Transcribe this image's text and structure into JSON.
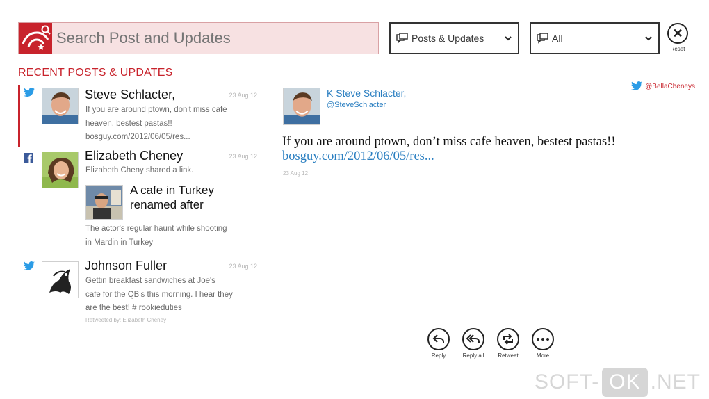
{
  "search": {
    "placeholder": "Search Post and Updates",
    "logo_icon": "people-search-logo-icon"
  },
  "filters": {
    "type": {
      "selected": "Posts & Updates"
    },
    "scope": {
      "selected": "All"
    }
  },
  "reset": {
    "label": "Reset"
  },
  "section_title": "RECENT POSTS & UPDATES",
  "colors": {
    "accent": "#c8232c",
    "link": "#2b7fc1",
    "twitter": "#2b9ce6",
    "facebook": "#3b5a9a"
  },
  "feed": [
    {
      "source": "twitter",
      "name": "Steve Schlacter,",
      "date": "23 Aug 12",
      "lines": [
        "If you are around ptown, don't miss cafe",
        "heaven, bestest pastas!!",
        "bosguy.com/2012/06/05/res..."
      ]
    },
    {
      "source": "facebook",
      "name": "Elizabeth Cheney",
      "date": "23 Aug 12",
      "lines": [
        "Elizabeth Cheny shared a link."
      ],
      "link_title_lines": [
        "A cafe in Turkey",
        "renamed after"
      ],
      "link_desc_lines": [
        "The actor's regular haunt while shooting",
        "in Mardin in Turkey"
      ]
    },
    {
      "source": "twitter",
      "name": "Johnson Fuller",
      "date": "23 Aug 12",
      "lines": [
        "Gettin breakfast sandwiches at Joe's",
        "cafe for the QB's this morning. I hear they",
        "are the best! # rookieduties"
      ],
      "retweeted_by": "Retweeted by: Elizabeth Cheney"
    }
  ],
  "detail": {
    "name": "K Steve Schlacter,",
    "handle": "@SteveSchlacter",
    "account": "@BellaCheneys",
    "text": "If you are around ptown, don’t miss cafe heaven, bestest pastas!!",
    "link": "bosguy.com/2012/06/05/res...",
    "date": "23 Aug 12"
  },
  "actions": [
    {
      "label": "Reply",
      "icon": "reply-icon"
    },
    {
      "label": "Reply all",
      "icon": "reply-all-icon"
    },
    {
      "label": "Retweet",
      "icon": "retweet-icon"
    },
    {
      "label": "More",
      "icon": "more-icon"
    }
  ],
  "watermark": {
    "left": "SOFT-",
    "box": "OK",
    "right": ".NET"
  }
}
